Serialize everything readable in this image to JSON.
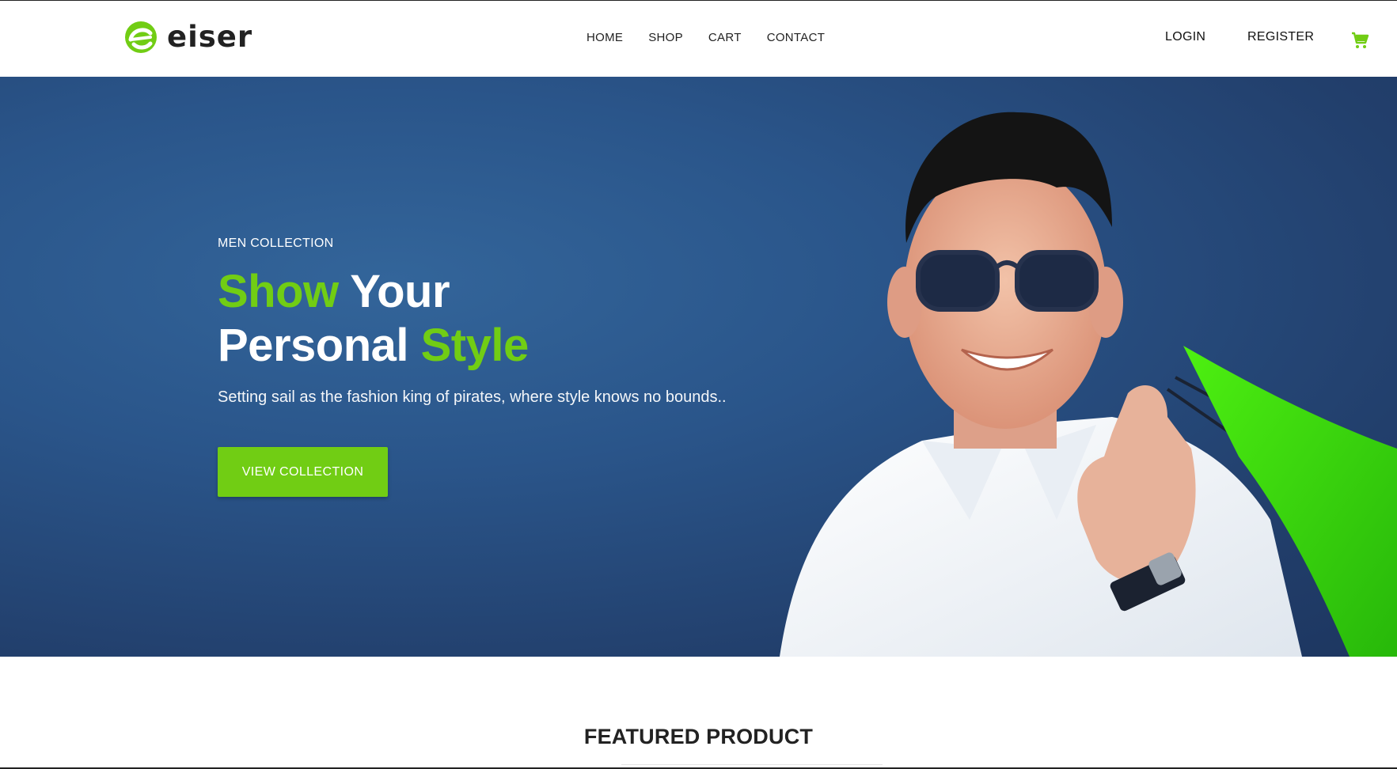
{
  "brand": {
    "name": "eiser",
    "accent_color": "#71cd14"
  },
  "nav": {
    "items": [
      {
        "label": "HOME"
      },
      {
        "label": "SHOP"
      },
      {
        "label": "CART"
      },
      {
        "label": "CONTACT"
      }
    ]
  },
  "auth": {
    "login_label": "LOGIN",
    "register_label": "REGISTER"
  },
  "cart": {
    "icon": "cart-icon"
  },
  "hero": {
    "eyebrow": "MEN COLLECTION",
    "title_line1_accent": "Show",
    "title_line1_rest": "Your",
    "title_line2_rest": "Personal",
    "title_line2_accent": "Style",
    "subtitle": "Setting sail as the fashion king of pirates, where style knows no bounds..",
    "cta_label": "VIEW COLLECTION",
    "background_color": "#2a558a"
  },
  "featured": {
    "title": "FEATURED PRODUCT"
  }
}
